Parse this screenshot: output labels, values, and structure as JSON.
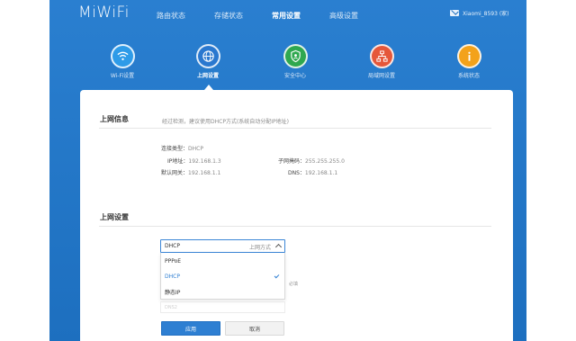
{
  "header": {
    "logo": "MiWiFi",
    "nav": [
      {
        "label": "路由状态",
        "active": false
      },
      {
        "label": "存储状态",
        "active": false
      },
      {
        "label": "常用设置",
        "active": true
      },
      {
        "label": "高级设置",
        "active": false
      }
    ],
    "user": "Xiaomi_8593 (家)"
  },
  "sections": [
    {
      "label": "Wi-Fi设置",
      "icon": "wifi-icon",
      "color": "#2e9be8",
      "active": false
    },
    {
      "label": "上网设置",
      "icon": "globe-icon",
      "color": "#2a78cf",
      "active": true
    },
    {
      "label": "安全中心",
      "icon": "shield-icon",
      "color": "#2fa84f",
      "active": false
    },
    {
      "label": "局域网设置",
      "icon": "network-icon",
      "color": "#e5573a",
      "active": false
    },
    {
      "label": "系统状态",
      "icon": "info-icon",
      "color": "#f3a21b",
      "active": false
    }
  ],
  "internet_info": {
    "title": "上网信息",
    "hint": "经过检测，建议使用DHCP方式(系统自动分配IP地址)",
    "conn_type_label": "连接类型：",
    "conn_type_value": "DHCP",
    "ip_label": "IP地址：",
    "ip_value": "192.168.1.3",
    "mask_label": "子网掩码：",
    "mask_value": "255.255.255.0",
    "gateway_label": "默认网关：",
    "gateway_value": "192.168.1.1",
    "dns_label": "DNS：",
    "dns_value": "192.168.1.1"
  },
  "internet_settings": {
    "title": "上网设置",
    "select_value": "DHCP",
    "select_tag": "上网方式",
    "options": [
      "PPPoE",
      "DHCP",
      "静态IP"
    ],
    "selected_index": 1,
    "required_hint": "必填",
    "ghost_placeholder": "DNS2",
    "apply_label": "应用",
    "cancel_label": "取消"
  }
}
